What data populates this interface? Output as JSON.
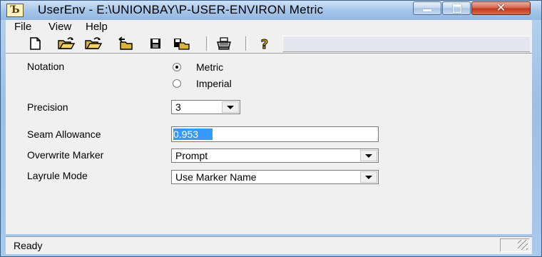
{
  "window": {
    "title": "UserEnv - E:\\UNIONBAY\\P-USER-ENVIRON Metric",
    "app_icon_glyph": "Ъ",
    "close_glyph": "✕"
  },
  "menu": {
    "items": [
      {
        "label": "File"
      },
      {
        "label": "View"
      },
      {
        "label": "Help"
      }
    ]
  },
  "toolbar": {
    "buttons": [
      {
        "icon": "new-document-icon"
      },
      {
        "icon": "open-folder-icon"
      },
      {
        "icon": "open-folder-alt-icon"
      },
      {
        "icon": "import-icon"
      },
      {
        "icon": "save-icon"
      },
      {
        "icon": "save-all-icon"
      },
      {
        "icon": "print-icon"
      },
      {
        "icon": "help-icon"
      }
    ],
    "help_glyph": "?"
  },
  "form": {
    "notation": {
      "label": "Notation",
      "options": [
        {
          "label": "Metric",
          "checked": true
        },
        {
          "label": "Imperial",
          "checked": false
        }
      ]
    },
    "precision": {
      "label": "Precision",
      "value": "3"
    },
    "seam_allowance": {
      "label": "Seam Allowance",
      "value": "0.953"
    },
    "overwrite_marker": {
      "label": "Overwrite Marker",
      "value": "Prompt"
    },
    "layrule_mode": {
      "label": "Layrule Mode",
      "value": "Use Marker Name"
    }
  },
  "status": {
    "text": "Ready"
  },
  "colors": {
    "selection": "#3399ff",
    "window_frame": "#a9c9ea",
    "client_bg": "#f0f0f0",
    "close_button": "#c1391c"
  }
}
